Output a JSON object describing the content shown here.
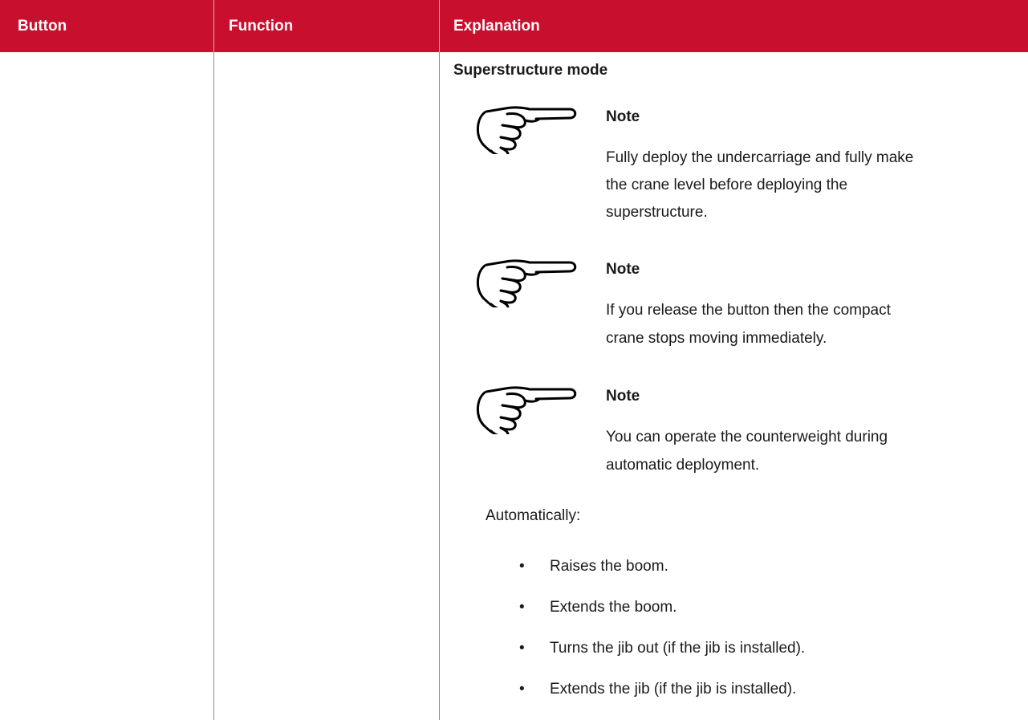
{
  "table": {
    "headers": [
      "Button",
      "Function",
      "Explanation"
    ],
    "header_color": "#c8102e"
  },
  "content": {
    "section_title": "Superstructure mode",
    "notes": [
      {
        "icon": "pointing-hand-icon",
        "title": "Note",
        "lines": [
          "Fully deploy the undercarriage and fully make",
          "the crane level before deploying the",
          "superstructure."
        ]
      },
      {
        "icon": "pointing-hand-icon",
        "title": "Note",
        "lines": [
          "If you release the button then the compact",
          "crane stops moving immediately."
        ]
      },
      {
        "icon": "pointing-hand-icon",
        "title": "Note",
        "lines": [
          "You can operate the counterweight during",
          "automatic deployment."
        ]
      }
    ],
    "intro": "Automatically:",
    "bullets": [
      "Raises the boom.",
      "Extends the boom.",
      "Turns the jib out (if the jib is installed).",
      "Extends the jib (if the jib is installed)."
    ]
  }
}
